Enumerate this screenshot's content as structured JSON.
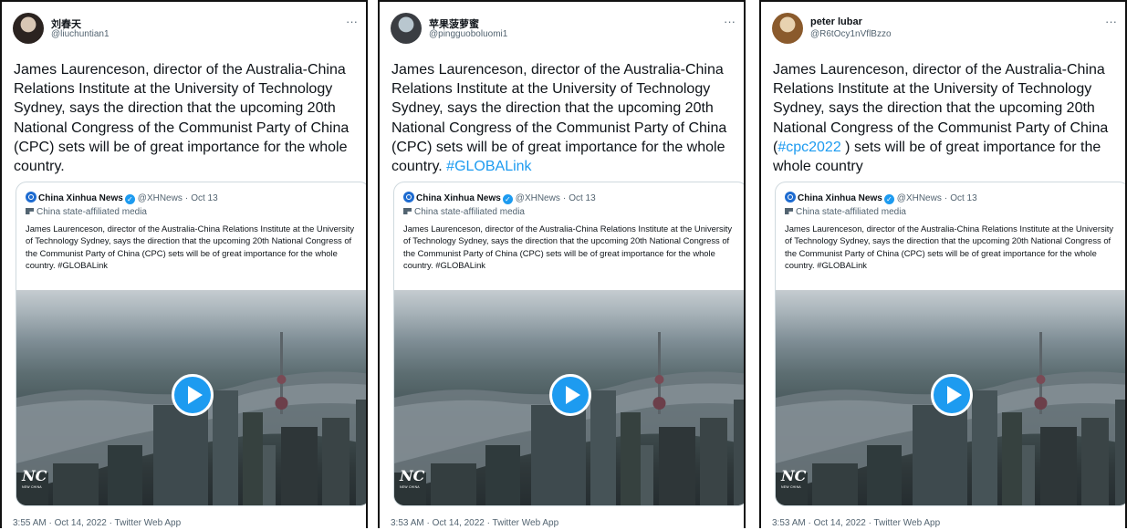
{
  "tweets": [
    {
      "name": "刘春天",
      "handle": "@liuchuntian1",
      "more": "···",
      "text_parts": [
        {
          "text": "James Laurenceson, director of the Australia-China Relations Institute at the University of Technology Sydney, says the direction that the upcoming 20th National Congress of the Communist Party of China (CPC) sets will be of great importance for the whole country.",
          "hashtag": false
        }
      ],
      "timestamp": "3:55 AM · Oct 14, 2022 · Twitter Web App"
    },
    {
      "name": "苹果菠萝蜜",
      "handle": "@pingguoboluomi1",
      "more": "···",
      "text_parts": [
        {
          "text": "James Laurenceson, director of the Australia-China Relations Institute at the University of Technology Sydney, says the direction that the upcoming 20th National Congress of the Communist Party of China (CPC) sets will be of great importance for the whole country. ",
          "hashtag": false
        },
        {
          "text": "#GLOBALink",
          "hashtag": true
        }
      ],
      "timestamp": "3:53 AM · Oct 14, 2022 · Twitter Web App"
    },
    {
      "name": "peter lubar",
      "handle": "@R6tOcy1nVflBzzo",
      "more": "···",
      "text_parts": [
        {
          "text": "James Laurenceson, director of the Australia-China Relations Institute at the University of Technology Sydney, says the direction that the upcoming 20th National Congress of the Communist Party of China (",
          "hashtag": false
        },
        {
          "text": "#cpc2022",
          "hashtag": true
        },
        {
          "text": " ) sets will be of great importance for the whole country",
          "hashtag": false
        }
      ],
      "timestamp": "3:53 AM · Oct 14, 2022 · Twitter Web App"
    }
  ],
  "quote": {
    "name": "China Xinhua News",
    "verified_glyph": "✓",
    "handle": "@XHNews",
    "separator": "·",
    "date": "Oct 13",
    "label": "China state-affiliated media",
    "text": "James Laurenceson, director of the Australia-China Relations Institute at the University of Technology Sydney, says the direction that the upcoming 20th National Congress of the Communist Party of China (CPC) sets will be of great importance for the whole country. #GLOBALink",
    "logo_text": "NC",
    "logo_sub": "NEW CHINA"
  },
  "colors": {
    "hashtag": "#1d9bf0",
    "verified": "#1d9bf0",
    "play_button": "#1d9bf0",
    "secondary_text": "#536471",
    "border": "#cfd9de"
  },
  "icons": [
    "more-options-icon",
    "verified-badge-icon",
    "state-media-flag-icon",
    "play-icon",
    "xinhua-logo-icon"
  ]
}
